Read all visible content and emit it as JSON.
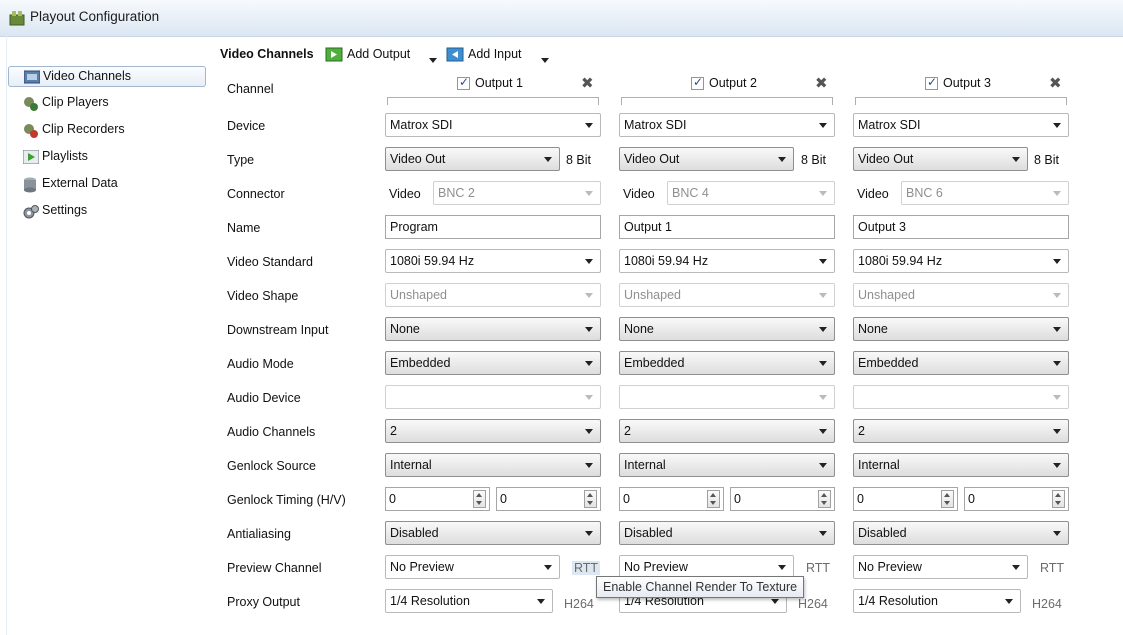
{
  "window": {
    "title": "Playout Configuration"
  },
  "sidebar": {
    "items": [
      {
        "label": "Video Channels",
        "icon": "video-channels-icon",
        "selected": true
      },
      {
        "label": "Clip Players",
        "icon": "clip-players-icon",
        "selected": false
      },
      {
        "label": "Clip Recorders",
        "icon": "clip-recorders-icon",
        "selected": false
      },
      {
        "label": "Playlists",
        "icon": "playlists-icon",
        "selected": false
      },
      {
        "label": "External Data",
        "icon": "external-data-icon",
        "selected": false
      },
      {
        "label": "Settings",
        "icon": "settings-icon",
        "selected": false
      }
    ]
  },
  "toolbar": {
    "title": "Video Channels",
    "add_output": "Add Output",
    "add_input": "Add Input"
  },
  "row_labels": {
    "channel": "Channel",
    "device": "Device",
    "type": "Type",
    "connector": "Connector",
    "name": "Name",
    "video_standard": "Video Standard",
    "video_shape": "Video Shape",
    "downstream_input": "Downstream Input",
    "audio_mode": "Audio Mode",
    "audio_device": "Audio Device",
    "audio_channels": "Audio Channels",
    "genlock_source": "Genlock Source",
    "genlock_timing": "Genlock Timing (H/V)",
    "antialiasing": "Antialiasing",
    "preview_channel": "Preview Channel",
    "proxy_output": "Proxy Output"
  },
  "channels": [
    {
      "output_label": "Output 1",
      "checked": true,
      "device": "Matrox SDI",
      "type": "Video Out",
      "bit_depth": "8 Bit",
      "connector_label": "Video",
      "connector": "BNC 2",
      "name": "Program",
      "video_standard": "1080i 59.94 Hz",
      "video_shape": "Unshaped",
      "downstream_input": "None",
      "audio_mode": "Embedded",
      "audio_device": "",
      "audio_channels": "2",
      "genlock_source": "Internal",
      "genlock_h": "0",
      "genlock_v": "0",
      "antialiasing": "Disabled",
      "preview_channel": "No Preview",
      "rtt": "RTT",
      "proxy_output": "1/4 Resolution",
      "proxy_codec": "H264"
    },
    {
      "output_label": "Output 2",
      "checked": true,
      "device": "Matrox SDI",
      "type": "Video Out",
      "bit_depth": "8 Bit",
      "connector_label": "Video",
      "connector": "BNC 4",
      "name": "Output 1",
      "video_standard": "1080i 59.94 Hz",
      "video_shape": "Unshaped",
      "downstream_input": "None",
      "audio_mode": "Embedded",
      "audio_device": "",
      "audio_channels": "2",
      "genlock_source": "Internal",
      "genlock_h": "0",
      "genlock_v": "0",
      "antialiasing": "Disabled",
      "preview_channel": "No Preview",
      "rtt": "RTT",
      "proxy_output": "1/4 Resolution",
      "proxy_codec": "H264"
    },
    {
      "output_label": "Output 3",
      "checked": true,
      "device": "Matrox SDI",
      "type": "Video Out",
      "bit_depth": "8 Bit",
      "connector_label": "Video",
      "connector": "BNC 6",
      "name": "Output 3",
      "video_standard": "1080i 59.94 Hz",
      "video_shape": "Unshaped",
      "downstream_input": "None",
      "audio_mode": "Embedded",
      "audio_device": "",
      "audio_channels": "2",
      "genlock_source": "Internal",
      "genlock_h": "0",
      "genlock_v": "0",
      "antialiasing": "Disabled",
      "preview_channel": "No Preview",
      "rtt": "RTT",
      "proxy_output": "1/4 Resolution",
      "proxy_codec": "H264"
    }
  ],
  "tooltip": {
    "text": "Enable Channel Render To Texture"
  }
}
